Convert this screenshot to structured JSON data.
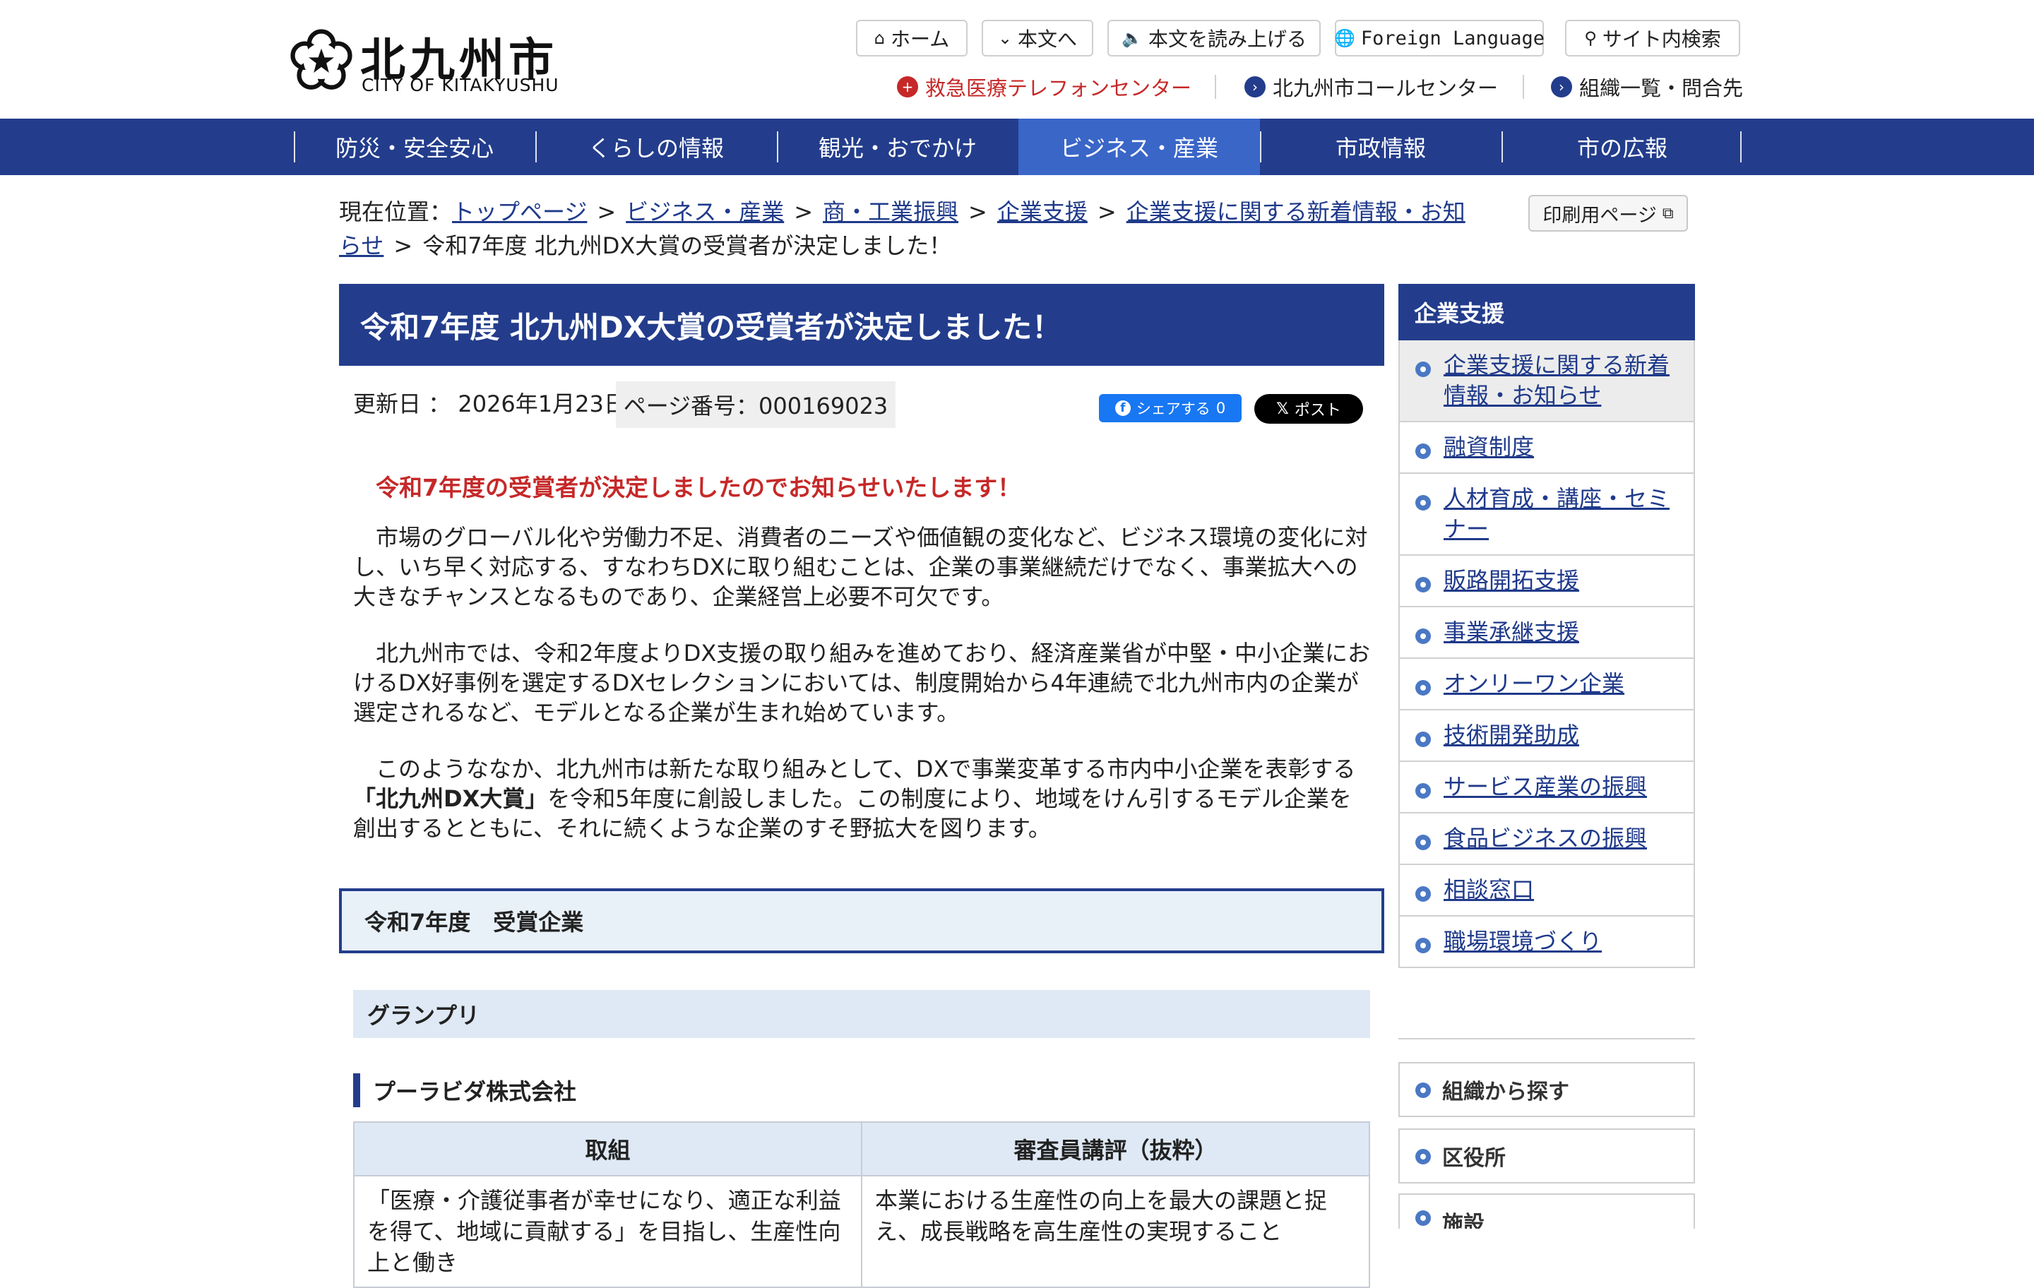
{
  "header": {
    "logo_jp": "北九州市",
    "logo_en": "CITY OF KITAKYUSHU",
    "utility": {
      "home": "ホーム",
      "skip": "本文へ",
      "read_aloud": "本文を読み上げる",
      "foreign": "Foreign Language",
      "search": "サイト内検索"
    },
    "sub_links": {
      "emergency": "救急医療テレフォンセンター",
      "call_center": "北九州市コールセンター",
      "organization": "組織一覧・問合先"
    }
  },
  "nav": {
    "items": [
      "防災・安全安心",
      "くらしの情報",
      "観光・おでかけ",
      "ビジネス・産業",
      "市政情報",
      "市の広報"
    ],
    "active_index": 3
  },
  "breadcrumb": {
    "prefix": "現在位置：",
    "links": [
      "トップページ",
      "ビジネス・産業",
      "商・工業振興",
      "企業支援",
      "企業支援に関する新着情報・お知らせ"
    ],
    "current": "令和7年度 北九州DX大賞の受賞者が決定しました！",
    "print_label": "印刷用ページ"
  },
  "article": {
    "title": "令和7年度 北九州DX大賞の受賞者が決定しました！",
    "updated": "更新日 ： 2026年1月23日",
    "page_number": "ページ番号：000169023",
    "share": {
      "fb_label": "シェアする",
      "fb_count": "0",
      "x_label": "ポスト"
    },
    "lead": "令和7年度の受賞者が決定しましたのでお知らせいたします！",
    "paragraphs": [
      "市場のグローバル化や労働力不足、消費者のニーズや価値観の変化など、ビジネス環境の変化に対し、いち早く対応する、すなわちDXに取り組むことは、企業の事業継続だけでなく、事業拡大への大きなチャンスとなるものであり、企業経営上必要不可欠です。",
      "北九州市では、令和2年度よりDX支援の取り組みを進めており、経済産業省が中堅・中小企業におけるDX好事例を選定するDXセレクションにおいては、制度開始から4年連続で北九州市内の企業が選定されるなど、モデルとなる企業が生まれ始めています。"
    ],
    "para3": {
      "before": "このようななか、北九州市は新たな取り組みとして、DXで事業変革する市内中小企業を表彰する",
      "bold": "「北九州DX大賞」",
      "after": "を令和5年度に創設しました。この制度により、地域をけん引するモデル企業を創出するとともに、それに続くような企業のすそ野拡大を図ります。"
    },
    "section_heading": "令和7年度　受賞企業",
    "grand_prix": "グランプリ",
    "company": "プーラビダ株式会社",
    "table": {
      "headers": [
        "取組",
        "審査員講評（抜粋）"
      ],
      "row": [
        "「医療・介護従事者が幸せになり、適正な利益を得て、地域に貢献する」を目指し、生産性向上と働き",
        "本業における生産性の向上を最大の課題と捉え、成長戦略を高生産性の実現すること"
      ]
    }
  },
  "sidebar": {
    "heading": "企業支援",
    "items": [
      "企業支援に関する新着情報・お知らせ",
      "融資制度",
      "人材育成・講座・セミナー",
      "販路開拓支援",
      "事業承継支援",
      "オンリーワン企業",
      "技術開発助成",
      "サービス産業の振興",
      "食品ビジネスの振興",
      "相談窓口",
      "職場環境づくり"
    ],
    "current_index": 0,
    "boxes": [
      "組織から探す",
      "区役所",
      "施設"
    ]
  },
  "colors": {
    "navy": "#233d8c",
    "nav_active": "#3a66c8",
    "alert_red": "#c62828",
    "link": "#1f3a8a",
    "facebook": "#1877f2"
  },
  "icons": [
    "home-icon",
    "chevron-down-icon",
    "speaker-icon",
    "globe-icon",
    "search-icon",
    "plus-icon",
    "chevron-right-icon",
    "external-window-icon",
    "facebook-icon",
    "x-icon",
    "bullet-icon"
  ]
}
